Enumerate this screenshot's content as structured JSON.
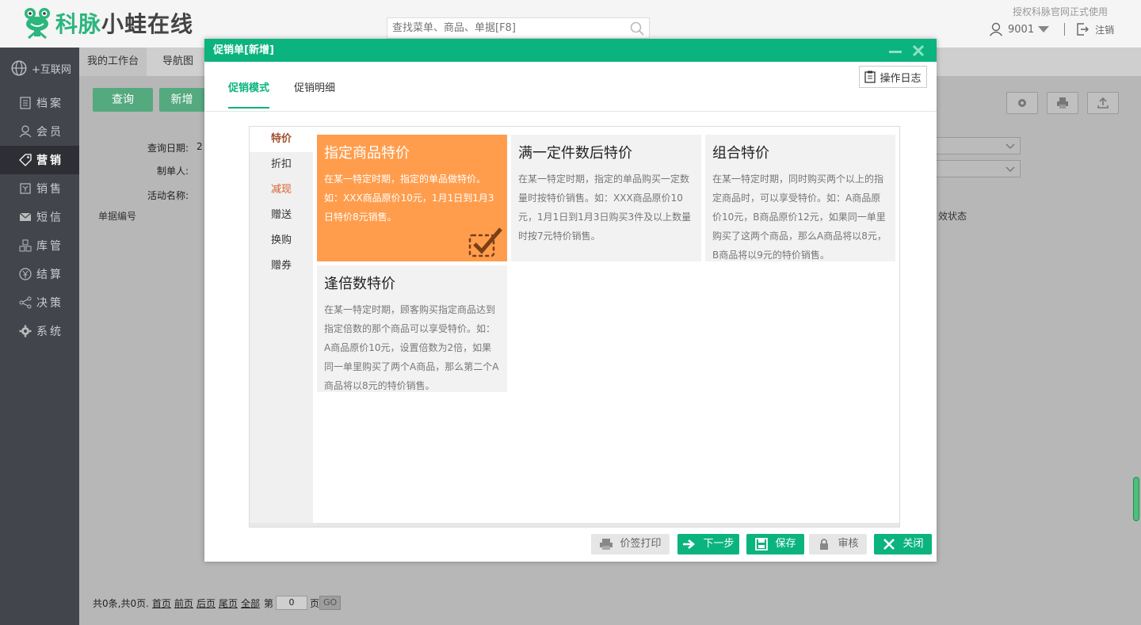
{
  "header": {
    "logo_part1": "科脉",
    "logo_part2": "小蛙在线",
    "search_placeholder": "查找菜单、商品、单据[F8]",
    "auth_note": "授权科脉官网正式使用",
    "user_id": "9001",
    "logout_label": "注销"
  },
  "sidebar": {
    "items": [
      {
        "label": "+互联网"
      },
      {
        "label": "档案"
      },
      {
        "label": "会员"
      },
      {
        "label": "营销"
      },
      {
        "label": "销售"
      },
      {
        "label": "短信"
      },
      {
        "label": "库管"
      },
      {
        "label": "结算"
      },
      {
        "label": "决策"
      },
      {
        "label": "系统"
      }
    ],
    "active_index": 3
  },
  "background": {
    "tabs": [
      "我的工作台",
      "导航图"
    ],
    "query_button": "查询",
    "add_button": "新增",
    "label_query_date": "查询日期:",
    "query_date_value": "2",
    "label_creator": "制单人:",
    "label_activity_name": "活动名称:",
    "column_doc_no": "单据编号",
    "column_status": "效状态",
    "pager": {
      "summary": "共0条,共0页.",
      "first": "首页",
      "prev": "前页",
      "next": "后页",
      "last": "尾页",
      "all": "全部",
      "page_prefix": "第",
      "page_value": "0",
      "page_suffix": "页",
      "go": "GO"
    }
  },
  "modal": {
    "title": "促销单[新增]",
    "tabs": [
      "促销模式",
      "促销明细"
    ],
    "active_tab": 0,
    "op_log_button": "操作日志",
    "categories": [
      "特价",
      "折扣",
      "减现",
      "赠送",
      "换购",
      "赠券"
    ],
    "active_category": 0,
    "cards": [
      {
        "title": "指定商品特价",
        "desc": "在某一特定时期，指定的单品做特价。如：XXX商品原价10元，1月1日到1月3日特价8元销售。",
        "selected": true
      },
      {
        "title": "满一定件数后特价",
        "desc": "在某一特定时期，指定的单品购买一定数量时按特价销售。如：XXX商品原价10元，1月1日到1月3日购买3件及以上数量时按7元特价销售。",
        "selected": false
      },
      {
        "title": "组合特价",
        "desc": "在某一特定时期，同时购买两个以上的指定商品时，可以享受特价。如：A商品原价10元，B商品原价12元，如果同一单里购买了这两个商品，那么A商品将以8元，B商品将以9元的特价销售。",
        "selected": false
      },
      {
        "title": "逢倍数特价",
        "desc": "在某一特定时期，顾客购买指定商品达到指定倍数的那个商品可以享受特价。如：A商品原价10元，设置倍数为2倍，如果同一单里购买了两个A商品，那么第二个A商品将以8元的特价销售。",
        "selected": false
      }
    ],
    "footer": {
      "price_print": "价签打印",
      "next_step": "下一步",
      "save": "保存",
      "audit": "审核",
      "close": "关闭"
    }
  },
  "colors": {
    "brand_green": "#0bb47e",
    "selected_card": "#ff9d4d",
    "sidebar_bg": "#43454d"
  }
}
